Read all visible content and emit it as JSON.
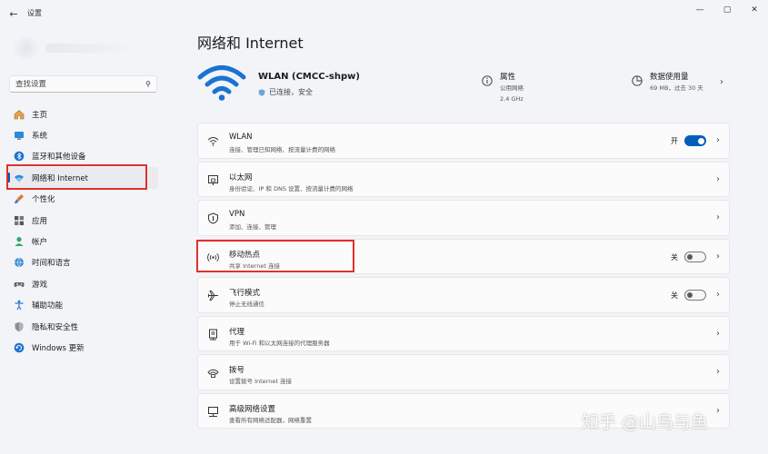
{
  "window": {
    "app_title": "设置",
    "back_glyph": "←",
    "minimize_glyph": "—",
    "maximize_glyph": "▢",
    "close_glyph": "✕"
  },
  "search": {
    "placeholder": "查找设置",
    "icon": "search-icon"
  },
  "sidebar": {
    "items": [
      {
        "label": "主页",
        "icon": "home-icon"
      },
      {
        "label": "系统",
        "icon": "system-icon"
      },
      {
        "label": "蓝牙和其他设备",
        "icon": "bluetooth-icon"
      },
      {
        "label": "网络和 Internet",
        "icon": "network-icon",
        "active": true
      },
      {
        "label": "个性化",
        "icon": "brush-icon"
      },
      {
        "label": "应用",
        "icon": "apps-icon"
      },
      {
        "label": "帐户",
        "icon": "account-icon"
      },
      {
        "label": "时间和语言",
        "icon": "globe-icon"
      },
      {
        "label": "游戏",
        "icon": "gamepad-icon"
      },
      {
        "label": "辅助功能",
        "icon": "accessibility-icon"
      },
      {
        "label": "隐私和安全性",
        "icon": "shield-icon"
      },
      {
        "label": "Windows 更新",
        "icon": "update-icon"
      }
    ]
  },
  "main": {
    "title": "网络和 Internet",
    "summary": {
      "network_name": "WLAN (CMCC-shpw)",
      "status": "已连接，安全",
      "properties": {
        "title": "属性",
        "line1": "公用网络",
        "line2": "2.4 GHz"
      },
      "data_usage": {
        "title": "数据使用量",
        "line1": "69 MB，过去 30 天"
      }
    },
    "cards": [
      {
        "title": "WLAN",
        "desc": "连接、管理已知网络、按流量计费的网络",
        "icon": "wifi-icon",
        "toggle": "on",
        "toggle_label": "开"
      },
      {
        "title": "以太网",
        "desc": "身份验证、IP 和 DNS 设置、按流量计费的网络",
        "icon": "ethernet-icon"
      },
      {
        "title": "VPN",
        "desc": "添加、连接、管理",
        "icon": "vpn-shield-icon"
      },
      {
        "title": "移动热点",
        "desc": "共享 Internet 连接",
        "icon": "hotspot-icon",
        "toggle": "off",
        "toggle_label": "关"
      },
      {
        "title": "飞行模式",
        "desc": "停止无线通信",
        "icon": "airplane-icon",
        "toggle": "off",
        "toggle_label": "关"
      },
      {
        "title": "代理",
        "desc": "用于 Wi-Fi 和以太网连接的代理服务器",
        "icon": "proxy-icon"
      },
      {
        "title": "拨号",
        "desc": "设置拨号 Internet 连接",
        "icon": "dialup-icon"
      },
      {
        "title": "高级网络设置",
        "desc": "查看所有网络适配器，网络重置",
        "icon": "advanced-network-icon"
      }
    ]
  },
  "watermark": "知乎 @山鸟与鱼",
  "colors": {
    "accent": "#005fb8",
    "highlight_box": "#e0302d",
    "background": "#f2f4f8"
  }
}
